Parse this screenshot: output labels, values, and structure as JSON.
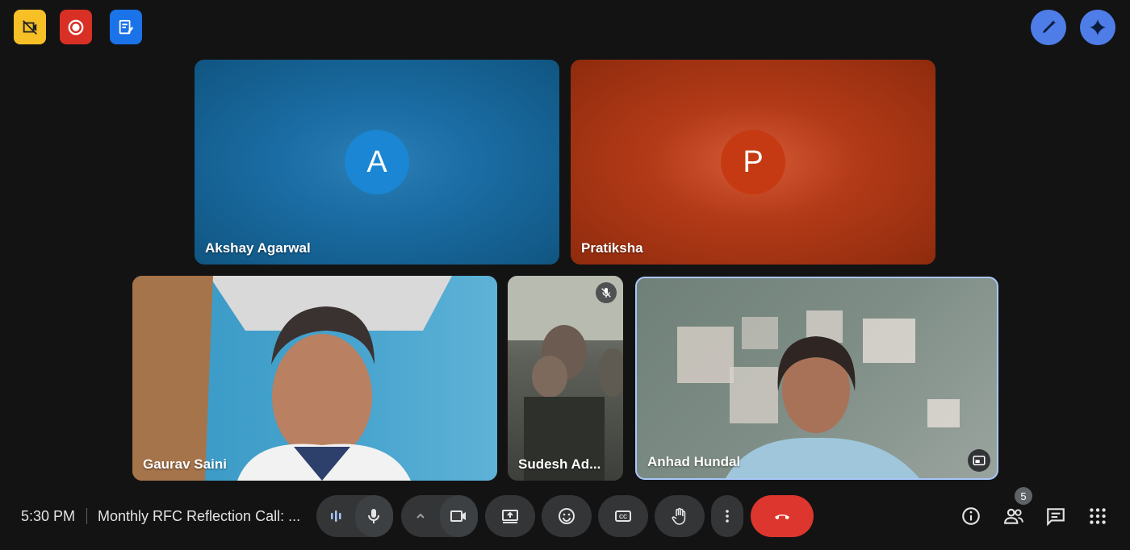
{
  "top_badges": [
    {
      "name": "no-video-icon",
      "color": "#f6c026"
    },
    {
      "name": "record-icon",
      "color": "#d93025"
    },
    {
      "name": "notes-icon",
      "color": "#1a73e8"
    }
  ],
  "top_right": [
    {
      "name": "pen-sparkle-icon"
    },
    {
      "name": "gemini-icon"
    }
  ],
  "participants": [
    {
      "name": "Akshay Agarwal",
      "initial": "A",
      "color": "#1a86d4"
    },
    {
      "name": "Pratiksha",
      "initial": "P",
      "color": "#c53a12"
    },
    {
      "name": "Gaurav Saini"
    },
    {
      "name": "Sudesh Ad...",
      "muted": true
    },
    {
      "name": "Anhad Hundal",
      "active": true
    }
  ],
  "bottom": {
    "time": "5:30 PM",
    "meeting_title": "Monthly RFC Reflection Call: ...",
    "participant_count": "5"
  },
  "colors": {
    "background": "#131314",
    "control": "#333537",
    "end_call": "#dc362e",
    "accent": "#a8c7fa"
  }
}
